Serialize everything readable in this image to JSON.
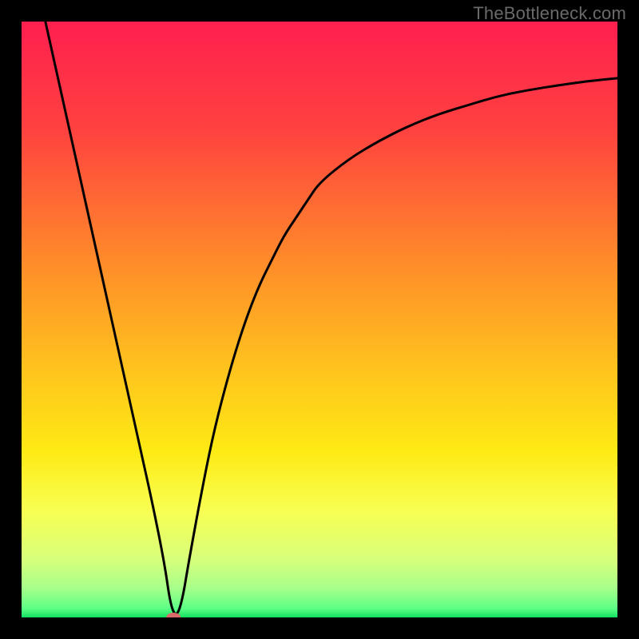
{
  "watermark": "TheBottleneck.com",
  "chart_data": {
    "type": "line",
    "title": "",
    "xlabel": "",
    "ylabel": "",
    "xlim": [
      0,
      100
    ],
    "ylim": [
      0,
      100
    ],
    "x": [
      4,
      6,
      8,
      10,
      12,
      14,
      16,
      18,
      20,
      22,
      24,
      25,
      26,
      27,
      28,
      30,
      32,
      34,
      36,
      38,
      40,
      42,
      44,
      46,
      48,
      50,
      55,
      60,
      65,
      70,
      75,
      80,
      85,
      90,
      95,
      100
    ],
    "y": [
      100,
      91,
      82,
      73,
      64,
      55,
      46,
      37,
      28,
      19,
      9,
      2,
      0,
      3,
      9,
      20,
      30,
      38,
      45,
      51,
      56,
      60,
      64,
      67,
      70,
      73,
      77,
      80,
      82.5,
      84.5,
      86,
      87.5,
      88.5,
      89.3,
      90,
      90.5
    ],
    "marker": {
      "x": 25.5,
      "y": 0
    },
    "gradient_stops": [
      {
        "offset": 0.0,
        "color": "#ff1f4f"
      },
      {
        "offset": 0.18,
        "color": "#ff4140"
      },
      {
        "offset": 0.4,
        "color": "#ff8a2a"
      },
      {
        "offset": 0.58,
        "color": "#ffc21e"
      },
      {
        "offset": 0.72,
        "color": "#feea14"
      },
      {
        "offset": 0.82,
        "color": "#f8ff52"
      },
      {
        "offset": 0.9,
        "color": "#d9ff7a"
      },
      {
        "offset": 0.95,
        "color": "#a8ff8a"
      },
      {
        "offset": 0.985,
        "color": "#5dff86"
      },
      {
        "offset": 1.0,
        "color": "#11e05e"
      }
    ]
  }
}
